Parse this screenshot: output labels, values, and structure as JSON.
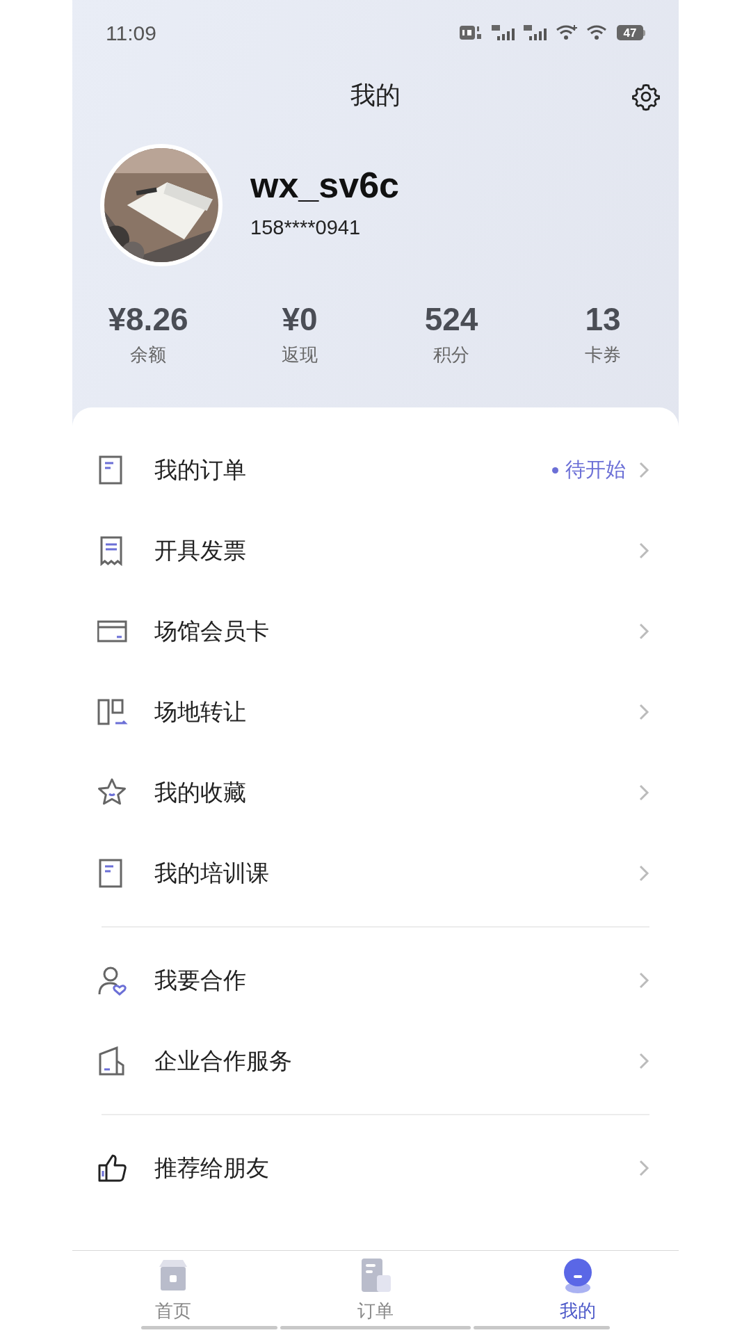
{
  "status_bar": {
    "time": "11:09",
    "battery": "47"
  },
  "header": {
    "title": "我的"
  },
  "profile": {
    "username": "wx_sv6c",
    "phone": "158****0941"
  },
  "stats": [
    {
      "value": "¥8.26",
      "label": "余额"
    },
    {
      "value": "¥0",
      "label": "返现"
    },
    {
      "value": "524",
      "label": "积分"
    },
    {
      "value": "13",
      "label": "卡券"
    }
  ],
  "menu_groups": [
    [
      {
        "label": "我的订单",
        "status": "待开始"
      },
      {
        "label": "开具发票"
      },
      {
        "label": "场馆会员卡"
      },
      {
        "label": "场地转让"
      },
      {
        "label": "我的收藏"
      },
      {
        "label": "我的培训课"
      }
    ],
    [
      {
        "label": "我要合作"
      },
      {
        "label": "企业合作服务"
      }
    ],
    [
      {
        "label": "推荐给朋友"
      }
    ]
  ],
  "tabs": [
    {
      "label": "首页",
      "selected": false
    },
    {
      "label": "订单",
      "selected": false
    },
    {
      "label": "我的",
      "selected": true
    }
  ]
}
